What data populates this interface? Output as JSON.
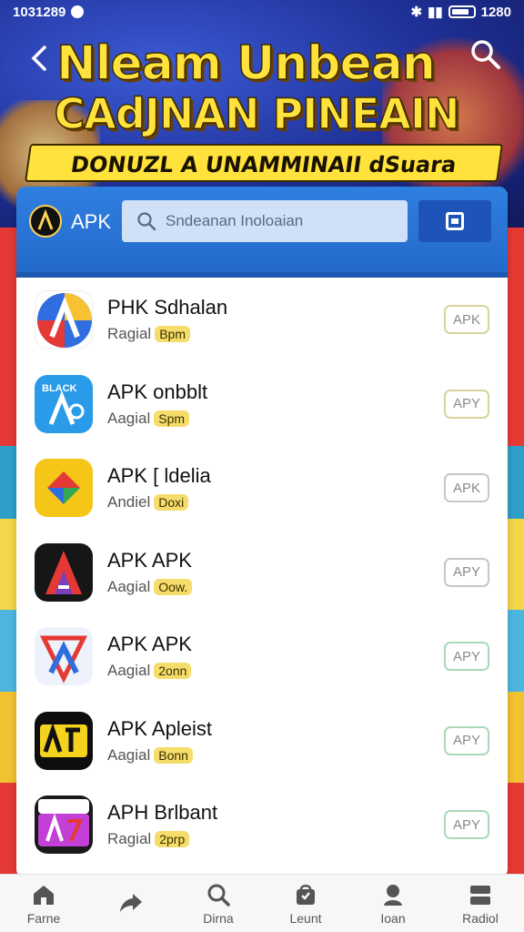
{
  "status_bar": {
    "time": "1031289",
    "right": "1280"
  },
  "banner": {
    "headline1": "Nleam Unbean",
    "headline2": "CAdJNAN PINEAIN",
    "tagline": "DONUZL A UNAMMINAII dSuara Unoaninck!"
  },
  "header": {
    "brand": "APK",
    "search_placeholder": "Sndeanan Inoloaian"
  },
  "apps": [
    {
      "title": "PHK Sdhalan",
      "meta": "Ragial",
      "badge": "Bpm",
      "button": "APK"
    },
    {
      "title": "APK onbblt",
      "meta": "Aagial",
      "badge": "Spm",
      "button": "APY"
    },
    {
      "title": "APK [ ldelia",
      "meta": "Andiel",
      "badge": "Doxi",
      "button": "APK"
    },
    {
      "title": "APK APK",
      "meta": "Aagial",
      "badge": "Oow.",
      "button": "APY"
    },
    {
      "title": "APK APK",
      "meta": "Aagial",
      "badge": "2onn",
      "button": "APY"
    },
    {
      "title": "APK Apleist",
      "meta": "Aagial",
      "badge": "Bonn",
      "button": "APY"
    },
    {
      "title": "APH Brlbant",
      "meta": "Ragial",
      "badge": "2prp",
      "button": "APY"
    }
  ],
  "nav": [
    {
      "label": "Farne"
    },
    {
      "label": ""
    },
    {
      "label": "Dirna"
    },
    {
      "label": "Leunt"
    },
    {
      "label": "Ioan"
    },
    {
      "label": "Radiol"
    }
  ]
}
